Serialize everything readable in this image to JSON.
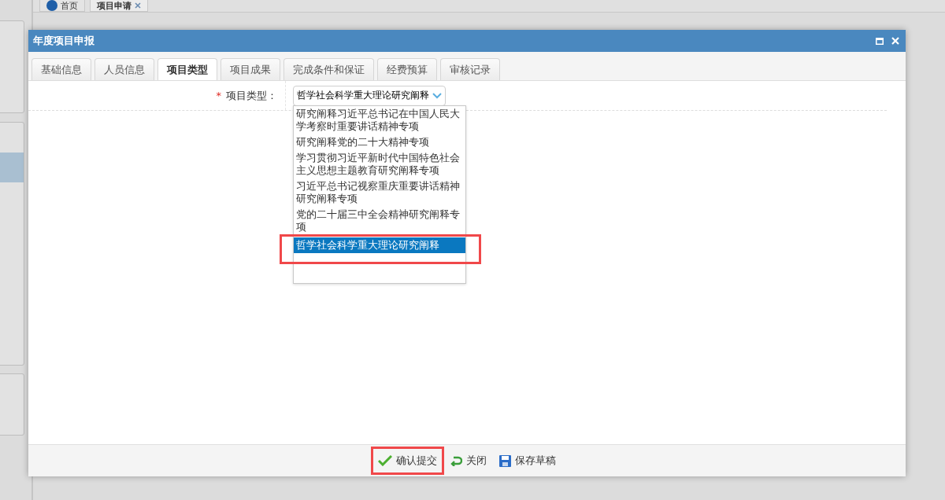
{
  "page_tabs": [
    {
      "label": "首页",
      "selected": false,
      "closable": false
    },
    {
      "label": "项目申请",
      "selected": true,
      "closable": true
    }
  ],
  "dialog": {
    "title": "年度项目申报"
  },
  "tabs": [
    {
      "label": "基础信息",
      "selected": false
    },
    {
      "label": "人员信息",
      "selected": false
    },
    {
      "label": "项目类型",
      "selected": true
    },
    {
      "label": "项目成果",
      "selected": false
    },
    {
      "label": "完成条件和保证",
      "selected": false
    },
    {
      "label": "经费预算",
      "selected": false
    },
    {
      "label": "审核记录",
      "selected": false
    }
  ],
  "form": {
    "label": "项目类型：",
    "required_mark": "*",
    "value": "哲学社会科学重大理论研究阐释",
    "options": [
      {
        "label": "研究阐释习近平总书记在中国人民大学考察时重要讲话精神专项",
        "selected": false,
        "annotated": false
      },
      {
        "label": "研究阐释党的二十大精神专项",
        "selected": false,
        "annotated": false
      },
      {
        "label": "学习贯彻习近平新时代中国特色社会主义思想主题教育研究阐释专项",
        "selected": false,
        "annotated": false
      },
      {
        "label": "习近平总书记视察重庆重要讲话精神研究阐释专项",
        "selected": false,
        "annotated": false
      },
      {
        "label": "党的二十届三中全会精神研究阐释专项",
        "selected": false,
        "annotated": false
      },
      {
        "label": "哲学社会科学重大理论研究阐释",
        "selected": true,
        "annotated": true
      }
    ]
  },
  "buttons": [
    {
      "kind": "confirm",
      "label": "确认提交",
      "annotated": true
    },
    {
      "kind": "close",
      "label": "关闭",
      "annotated": false
    },
    {
      "kind": "save",
      "label": "保存草稿",
      "annotated": false
    }
  ]
}
